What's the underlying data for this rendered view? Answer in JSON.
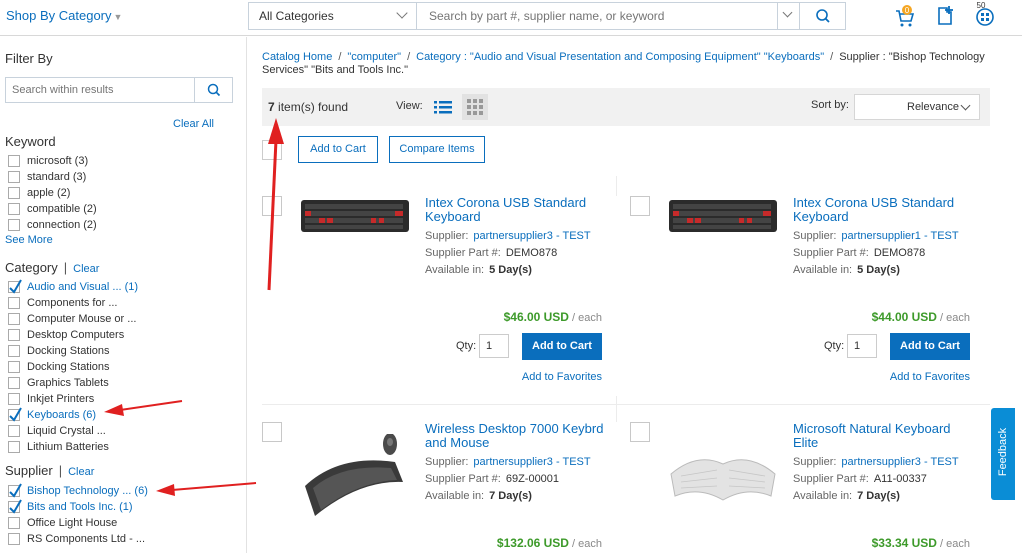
{
  "topbar": {
    "shop_by": "Shop By Category",
    "category_value": "All Categories",
    "search_placeholder": "Search by part #, supplier name, or keyword",
    "cart_count": "0",
    "catalog_count": "50"
  },
  "filters": {
    "title": "Filter By",
    "search_placeholder": "Search within results",
    "clear_all": "Clear All",
    "keyword": {
      "title": "Keyword",
      "items": [
        {
          "label": "microsoft",
          "count": "(3)",
          "checked": false
        },
        {
          "label": "standard",
          "count": "(3)",
          "checked": false
        },
        {
          "label": "apple",
          "count": "(2)",
          "checked": false
        },
        {
          "label": "compatible",
          "count": "(2)",
          "checked": false
        },
        {
          "label": "connection",
          "count": "(2)",
          "checked": false
        }
      ],
      "see_more": "See More"
    },
    "category": {
      "title": "Category",
      "clear": "Clear",
      "items": [
        {
          "label": "Audio and Visual ...",
          "count": "(1)",
          "checked": true
        },
        {
          "label": "Components for ...",
          "count": "",
          "checked": false
        },
        {
          "label": "Computer Mouse or ...",
          "count": "",
          "checked": false
        },
        {
          "label": "Desktop Computers",
          "count": "",
          "checked": false
        },
        {
          "label": "Docking Stations",
          "count": "",
          "checked": false
        },
        {
          "label": "Docking Stations",
          "count": "",
          "checked": false
        },
        {
          "label": "Graphics Tablets",
          "count": "",
          "checked": false
        },
        {
          "label": "Inkjet Printers",
          "count": "",
          "checked": false
        },
        {
          "label": "Keyboards",
          "count": "(6)",
          "checked": true
        },
        {
          "label": "Liquid Crystal ...",
          "count": "",
          "checked": false
        },
        {
          "label": "Lithium Batteries",
          "count": "",
          "checked": false
        }
      ]
    },
    "supplier": {
      "title": "Supplier",
      "clear": "Clear",
      "items": [
        {
          "label": "Bishop Technology ...",
          "count": "(6)",
          "checked": true
        },
        {
          "label": "Bits and Tools Inc.",
          "count": "(1)",
          "checked": true
        },
        {
          "label": "Office Light House",
          "count": "",
          "checked": false
        },
        {
          "label": "RS Components Ltd - ...",
          "count": "",
          "checked": false
        }
      ]
    }
  },
  "breadcrumb": {
    "home": "Catalog Home",
    "query": "\"computer\"",
    "category": "Category : \"Audio and Visual Presentation and Composing Equipment\"",
    "keyboards": "\"Keyboards\"",
    "supplier": "Supplier : \"Bishop Technology Services\" \"Bits and Tools Inc.\""
  },
  "results": {
    "count": "7",
    "count_suffix": " item(s) found",
    "view_label": "View:",
    "sort_label": "Sort by:",
    "sort_value": "Relevance",
    "add_to_cart": "Add to Cart",
    "compare": "Compare Items"
  },
  "products": [
    {
      "title": "Intex Corona USB Standard Keyboard",
      "supplier_label": "Supplier:",
      "supplier": "partnersupplier3 - TEST",
      "part_label": "Supplier Part #:",
      "part": "DEMO878",
      "avail_label": "Available in:",
      "avail": "5 Day(s)",
      "price": "$46.00 USD",
      "unit": " / each",
      "qty_label": "Qty:",
      "qty": "1",
      "cart": "Add to Cart",
      "fav": "Add to Favorites"
    },
    {
      "title": "Intex Corona USB Standard Keyboard",
      "supplier_label": "Supplier:",
      "supplier": "partnersupplier1 - TEST",
      "part_label": "Supplier Part #:",
      "part": "DEMO878",
      "avail_label": "Available in:",
      "avail": "5 Day(s)",
      "price": "$44.00 USD",
      "unit": " / each",
      "qty_label": "Qty:",
      "qty": "1",
      "cart": "Add to Cart",
      "fav": "Add to Favorites"
    },
    {
      "title": "Wireless Desktop 7000 Keybrd and Mouse",
      "supplier_label": "Supplier:",
      "supplier": "partnersupplier3 - TEST",
      "part_label": "Supplier Part #:",
      "part": "69Z-00001",
      "avail_label": "Available in:",
      "avail": "7 Day(s)",
      "price": "$132.06 USD",
      "unit": " / each"
    },
    {
      "title": "Microsoft Natural Keyboard Elite",
      "supplier_label": "Supplier:",
      "supplier": "partnersupplier3 - TEST",
      "part_label": "Supplier Part #:",
      "part": "A11-00337",
      "avail_label": "Available in:",
      "avail": "7 Day(s)",
      "price": "$33.34 USD",
      "unit": " / each"
    }
  ],
  "feedback": "Feedback",
  "colors": {
    "accent": "#0a6ebd",
    "price": "#3d9a2a",
    "annotation": "#e02020",
    "feedback": "#0a8dd6"
  }
}
